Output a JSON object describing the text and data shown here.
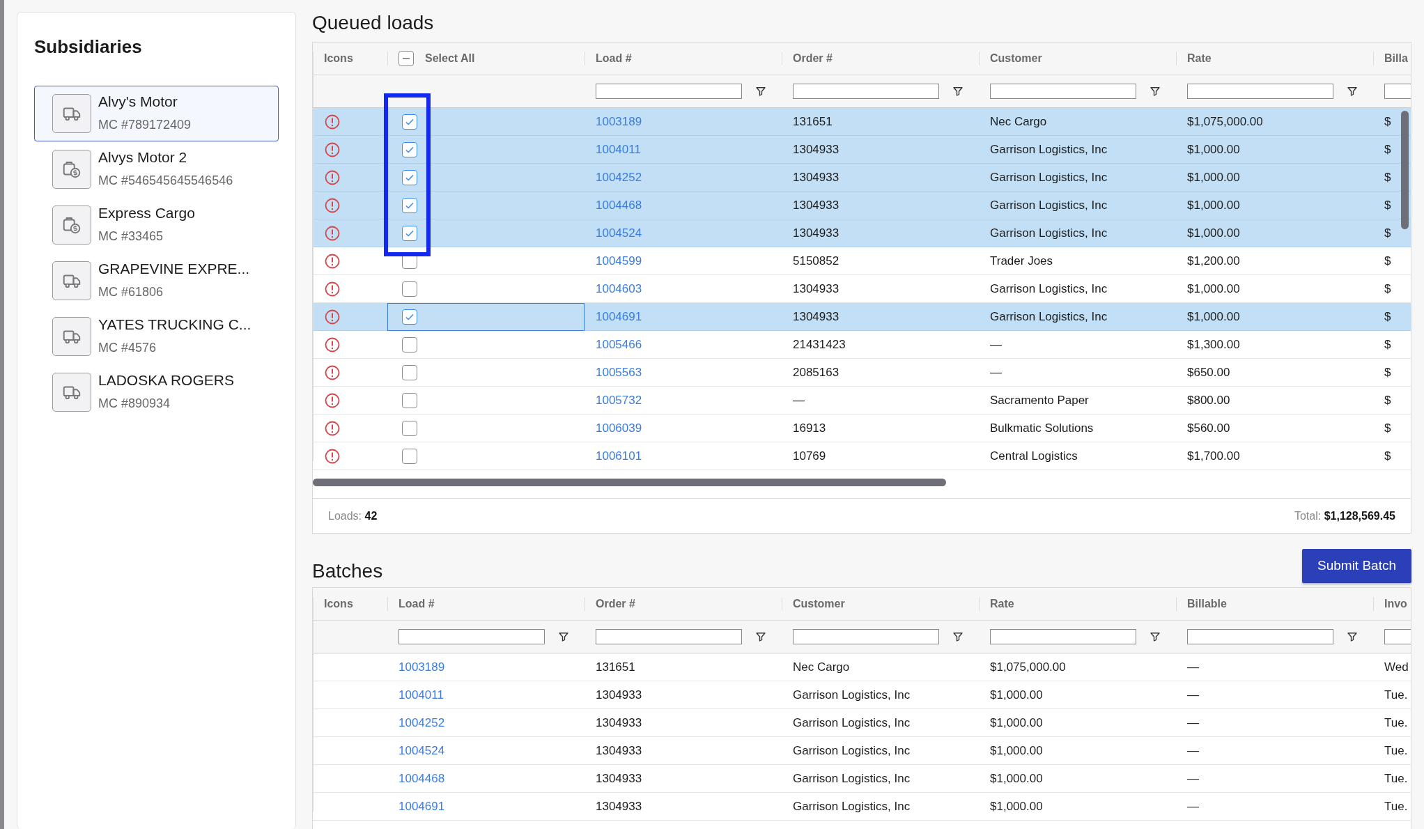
{
  "sidebar": {
    "title": "Subsidiaries",
    "items": [
      {
        "name": "Alvy's Motor",
        "mc": "MC #789172409",
        "kind": "truck",
        "selected": true
      },
      {
        "name": "Alvys Motor 2",
        "mc": "MC #546545645546546",
        "kind": "cargo",
        "selected": false
      },
      {
        "name": "Express Cargo",
        "mc": "MC #33465",
        "kind": "cargo",
        "selected": false
      },
      {
        "name": "GRAPEVINE EXPRE...",
        "mc": "MC #61806",
        "kind": "truck",
        "selected": false
      },
      {
        "name": "YATES TRUCKING C...",
        "mc": "MC #4576",
        "kind": "truck",
        "selected": false
      },
      {
        "name": "LADOSKA ROGERS",
        "mc": "MC #890934",
        "kind": "truck",
        "selected": false
      }
    ]
  },
  "queued": {
    "title": "Queued loads",
    "columns": [
      {
        "label": "Icons",
        "kind": "icons"
      },
      {
        "label": "Select All",
        "kind": "select",
        "indeterminate": true
      },
      {
        "label": "Load #",
        "kind": "link"
      },
      {
        "label": "Order #",
        "kind": "text"
      },
      {
        "label": "Customer",
        "kind": "text"
      },
      {
        "label": "Rate",
        "kind": "text"
      },
      {
        "label": "Billa",
        "kind": "text"
      }
    ],
    "rows": [
      {
        "warning": true,
        "checked": true,
        "selected": true,
        "focused": false,
        "boxed": true,
        "cells": [
          "",
          "",
          "1003189",
          "131651",
          "Nec Cargo",
          "$1,075,000.00",
          "$"
        ]
      },
      {
        "warning": true,
        "checked": true,
        "selected": true,
        "focused": false,
        "boxed": true,
        "cells": [
          "",
          "",
          "1004011",
          "1304933",
          "Garrison Logistics, Inc",
          "$1,000.00",
          "$"
        ]
      },
      {
        "warning": true,
        "checked": true,
        "selected": true,
        "focused": false,
        "boxed": true,
        "cells": [
          "",
          "",
          "1004252",
          "1304933",
          "Garrison Logistics, Inc",
          "$1,000.00",
          "$"
        ]
      },
      {
        "warning": true,
        "checked": true,
        "selected": true,
        "focused": false,
        "boxed": true,
        "cells": [
          "",
          "",
          "1004468",
          "1304933",
          "Garrison Logistics, Inc",
          "$1,000.00",
          "$"
        ]
      },
      {
        "warning": true,
        "checked": true,
        "selected": true,
        "focused": false,
        "boxed": true,
        "cells": [
          "",
          "",
          "1004524",
          "1304933",
          "Garrison Logistics, Inc",
          "$1,000.00",
          "$"
        ]
      },
      {
        "warning": true,
        "checked": false,
        "selected": false,
        "focused": false,
        "boxed": false,
        "cells": [
          "",
          "",
          "1004599",
          "5150852",
          "Trader Joes",
          "$1,200.00",
          "$"
        ]
      },
      {
        "warning": true,
        "checked": false,
        "selected": false,
        "focused": false,
        "boxed": false,
        "cells": [
          "",
          "",
          "1004603",
          "1304933",
          "Garrison Logistics, Inc",
          "$1,000.00",
          "$"
        ]
      },
      {
        "warning": true,
        "checked": true,
        "selected": true,
        "focused": true,
        "boxed": false,
        "cells": [
          "",
          "",
          "1004691",
          "1304933",
          "Garrison Logistics, Inc",
          "$1,000.00",
          "$"
        ]
      },
      {
        "warning": true,
        "checked": false,
        "selected": false,
        "focused": false,
        "boxed": false,
        "cells": [
          "",
          "",
          "1005466",
          "21431423",
          "—",
          "$1,300.00",
          "$"
        ]
      },
      {
        "warning": true,
        "checked": false,
        "selected": false,
        "focused": false,
        "boxed": false,
        "cells": [
          "",
          "",
          "1005563",
          "2085163",
          "—",
          "$650.00",
          "$"
        ]
      },
      {
        "warning": true,
        "checked": false,
        "selected": false,
        "focused": false,
        "boxed": false,
        "cells": [
          "",
          "",
          "1005732",
          "—",
          "Sacramento Paper",
          "$800.00",
          "$"
        ]
      },
      {
        "warning": true,
        "checked": false,
        "selected": false,
        "focused": false,
        "boxed": false,
        "cells": [
          "",
          "",
          "1006039",
          "16913",
          "Bulkmatic Solutions",
          "$560.00",
          "$"
        ]
      },
      {
        "warning": true,
        "checked": false,
        "selected": false,
        "focused": false,
        "boxed": false,
        "cells": [
          "",
          "",
          "1006101",
          "10769",
          "Central Logistics",
          "$1,700.00",
          "$"
        ]
      }
    ],
    "footer": {
      "loads_label": "Loads:",
      "loads_value": "42",
      "total_label": "Total:",
      "total_value": "$1,128,569.45"
    }
  },
  "batches": {
    "title": "Batches",
    "submit_button": "Submit Batch",
    "columns": [
      {
        "label": "Icons",
        "kind": "icons"
      },
      {
        "label": "Load #",
        "kind": "link"
      },
      {
        "label": "Order #",
        "kind": "text"
      },
      {
        "label": "Customer",
        "kind": "text"
      },
      {
        "label": "Rate",
        "kind": "text"
      },
      {
        "label": "Billable",
        "kind": "text"
      },
      {
        "label": "Invo",
        "kind": "text"
      }
    ],
    "rows": [
      {
        "cells": [
          "",
          "1003189",
          "131651",
          "Nec Cargo",
          "$1,075,000.00",
          "—",
          "Wed"
        ]
      },
      {
        "cells": [
          "",
          "1004011",
          "1304933",
          "Garrison Logistics, Inc",
          "$1,000.00",
          "—",
          "Tue."
        ]
      },
      {
        "cells": [
          "",
          "1004252",
          "1304933",
          "Garrison Logistics, Inc",
          "$1,000.00",
          "—",
          "Tue."
        ]
      },
      {
        "cells": [
          "",
          "1004524",
          "1304933",
          "Garrison Logistics, Inc",
          "$1,000.00",
          "—",
          "Tue."
        ]
      },
      {
        "cells": [
          "",
          "1004468",
          "1304933",
          "Garrison Logistics, Inc",
          "$1,000.00",
          "—",
          "Tue."
        ]
      },
      {
        "cells": [
          "",
          "1004691",
          "1304933",
          "Garrison Logistics, Inc",
          "$1,000.00",
          "—",
          "Tue."
        ]
      }
    ]
  }
}
